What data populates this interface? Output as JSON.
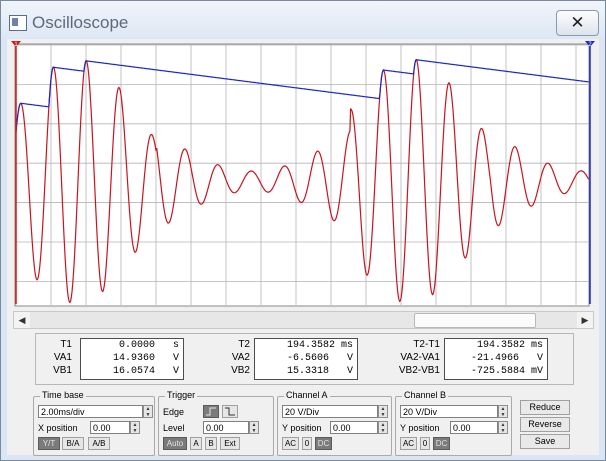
{
  "window": {
    "title": "Oscilloscope",
    "close_glyph": "✕"
  },
  "cursors": {
    "cursor1_label": "1",
    "cursor2_label": "2",
    "cursor1_color": "#d01818",
    "cursor2_color": "#1c28c8"
  },
  "traces": {
    "channel_a_color": "#c8141e",
    "channel_b_color": "#1c26c2",
    "grid_color": "#b4b4b4",
    "background": "#ffffff"
  },
  "scrollbar": {
    "left_arrow": "◀",
    "right_arrow": "▶"
  },
  "readout": {
    "t1": {
      "label": "T1",
      "value": "0.0000",
      "unit": "s"
    },
    "va1": {
      "label": "VA1",
      "value": "14.9360",
      "unit": "V"
    },
    "vb1": {
      "label": "VB1",
      "value": "16.0574",
      "unit": "V"
    },
    "t2": {
      "label": "T2",
      "value": "194.3582",
      "unit": "ms"
    },
    "va2": {
      "label": "VA2",
      "value": "-6.5606",
      "unit": "V"
    },
    "vb2": {
      "label": "VB2",
      "value": "15.3318",
      "unit": "V"
    },
    "dt": {
      "label": "T2-T1",
      "value": "194.3582",
      "unit": "ms"
    },
    "dva": {
      "label": "VA2-VA1",
      "value": "-21.4966",
      "unit": "V"
    },
    "dvb": {
      "label": "VB2-VB1",
      "value": "-725.5884",
      "unit": "mV"
    }
  },
  "timebase": {
    "title": "Time base",
    "value": "2.00ms/div",
    "xpos_label": "X position",
    "xpos_value": "0.00",
    "modes": [
      "Y/T",
      "B/A",
      "A/B"
    ],
    "selected_mode": "Y/T"
  },
  "trigger": {
    "title": "Trigger",
    "edge_label": "Edge",
    "level_label": "Level",
    "level_value": "0.00",
    "buttons": [
      "Auto",
      "A",
      "B",
      "Ext"
    ],
    "selected": "Auto"
  },
  "channel_a": {
    "title": "Channel A",
    "volts_div": "20 V/Div",
    "ypos_label": "Y position",
    "ypos_value": "0.00",
    "coupling": [
      "AC",
      "0",
      "DC"
    ],
    "selected": "DC"
  },
  "channel_b": {
    "title": "Channel B",
    "volts_div": "20 V/Div",
    "ypos_label": "Y position",
    "ypos_value": "0.00",
    "coupling": [
      "AC",
      "0",
      "DC"
    ],
    "selected": "DC"
  },
  "actions": {
    "reduce": "Reduce",
    "reverse": "Reverse",
    "save": "Save"
  }
}
